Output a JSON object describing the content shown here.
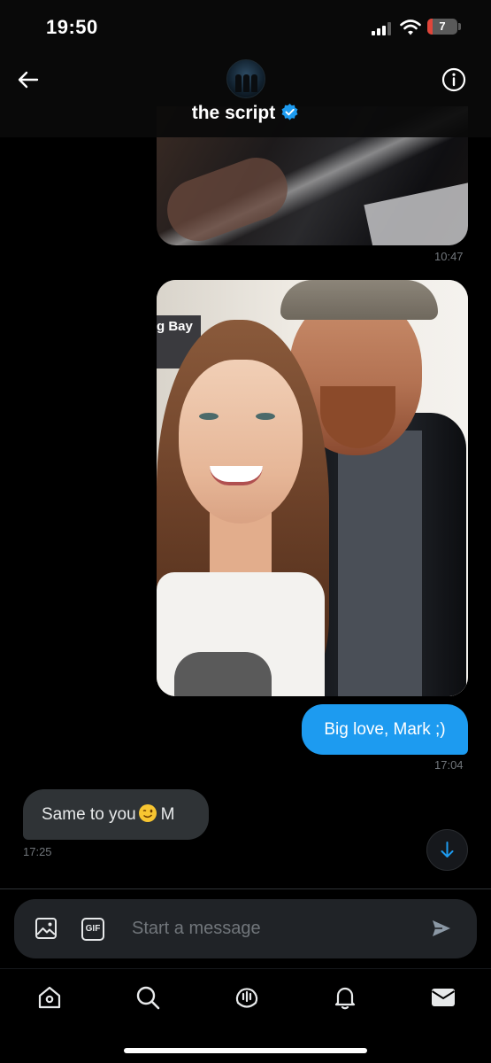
{
  "status_bar": {
    "time": "19:50",
    "battery_level": "7"
  },
  "header": {
    "title": "the script",
    "verified": true,
    "back_icon": "arrow-left-icon",
    "info_icon": "info-icon"
  },
  "messages": [
    {
      "type": "image",
      "direction": "sent",
      "description_icon": "photo",
      "timestamp": "10:47"
    },
    {
      "type": "image",
      "direction": "sent",
      "overlay_text": "g Bay"
    },
    {
      "type": "text",
      "direction": "sent",
      "text": "Big love, Mark ;)",
      "timestamp": "17:04"
    },
    {
      "type": "text",
      "direction": "received",
      "text_before": "Same to you",
      "emoji": "winking-face",
      "text_after": "M",
      "timestamp": "17:25"
    }
  ],
  "composer": {
    "placeholder": "Start a message",
    "gif_label": "GIF"
  },
  "nav": [
    "home-icon",
    "search-icon",
    "spaces-icon",
    "notifications-icon",
    "messages-icon"
  ],
  "colors": {
    "accent": "#1d9bf0",
    "received_bubble": "#2f3336",
    "background": "#000000"
  }
}
